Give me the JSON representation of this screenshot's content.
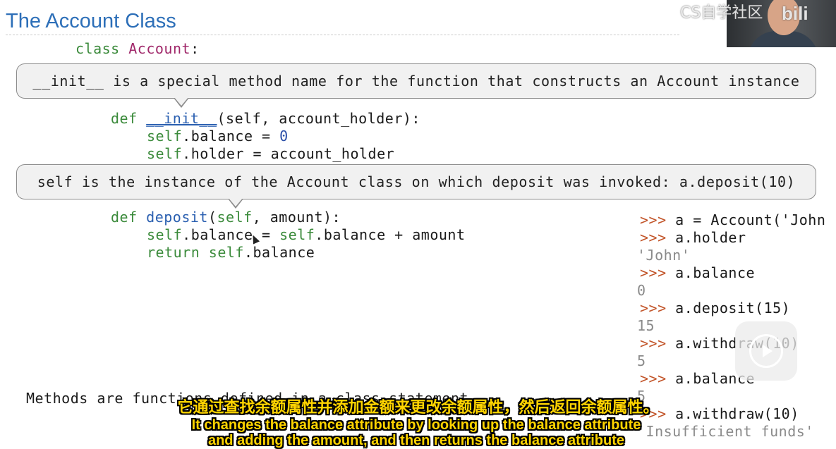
{
  "slide": {
    "title": "The Account Class",
    "footer_text": "Methods are functions defined in a class statement"
  },
  "code": {
    "class_kw": "class",
    "class_name": "Account",
    "class_colon": ":",
    "init_def": "def",
    "init_name": "__init__",
    "init_params": "(self, account_holder):",
    "line_balance_self": "self",
    "line_balance_rest": ".balance = ",
    "line_balance_val": "0",
    "line_holder_self": "self",
    "line_holder_rest": ".holder = account_holder",
    "deposit_def": "def",
    "deposit_name": "deposit",
    "deposit_params_open": "(",
    "deposit_params_self": "self",
    "deposit_params_rest": ", amount):",
    "dep_line1_self": "self",
    "dep_line1_mid": ".balance = ",
    "dep_line1_self2": "self",
    "dep_line1_end": ".balance + amount",
    "dep_line2_kw": "return ",
    "dep_line2_self": "self",
    "dep_line2_end": ".balance"
  },
  "callouts": {
    "init_note": "__init__ is a special method name for the function that constructs an Account instance",
    "self_note": "self is the instance of the Account class on which deposit was invoked: a.deposit(10)"
  },
  "repl": {
    "prompt": ">>>",
    "lines": [
      {
        "cmd": "a = Account('John"
      },
      {
        "cmd": "a.holder"
      },
      {
        "out": "'John'"
      },
      {
        "cmd": "a.balance"
      },
      {
        "out": "0"
      },
      {
        "cmd": "a.deposit(15)"
      },
      {
        "out": "15"
      },
      {
        "cmd": "a.withdraw(10)"
      },
      {
        "out": "5"
      },
      {
        "cmd": "a.balance"
      },
      {
        "out": "5"
      },
      {
        "cmd": "a.withdraw(10)"
      },
      {
        "out": "'Insufficient funds'"
      }
    ]
  },
  "overlay": {
    "watermark": "CS自学社区",
    "brand": "bili",
    "subtitle_cn": "它通过查找余额属性并添加金额来更改余额属性，然后返回余额属性。",
    "subtitle_en_1": "It changes the balance attribute by looking up the balance attribute",
    "subtitle_en_2": "and adding the amount, and then returns the balance attribute",
    "icons": {
      "play": "play-icon",
      "cursor": "mouse-cursor-icon"
    }
  }
}
